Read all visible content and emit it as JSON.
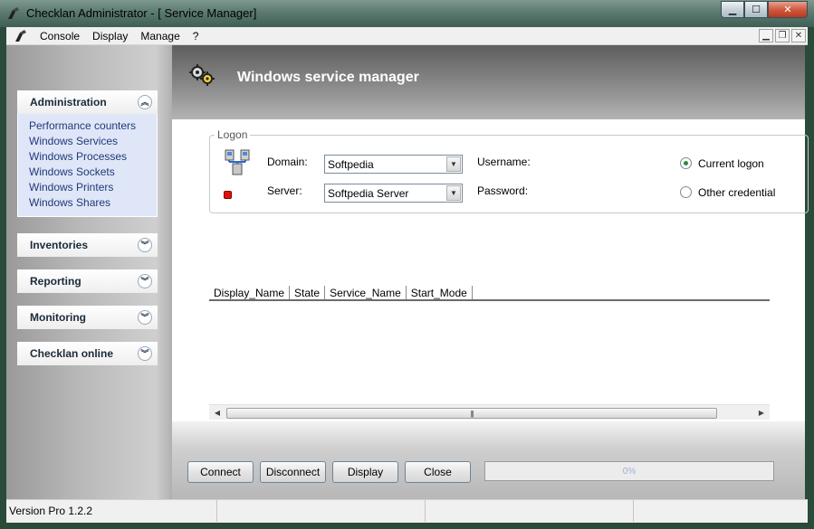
{
  "window": {
    "title": "Checklan Administrator - [ Service Manager]",
    "min_glyph": "▁",
    "max_glyph": "☐",
    "close_glyph": "✕"
  },
  "mdi": {
    "min_glyph": "▁",
    "restore_glyph": "❐",
    "close_glyph": "✕"
  },
  "menu": {
    "items": [
      "Console",
      "Display",
      "Manage",
      "?"
    ]
  },
  "sidebar": {
    "groups": [
      {
        "title": "Administration",
        "expanded": true,
        "chevron": "︽",
        "items": [
          "Performance counters",
          "Windows Services",
          "Windows Processes",
          "Windows Sockets",
          "Windows Printers",
          "Windows Shares"
        ]
      },
      {
        "title": "Inventories",
        "expanded": false,
        "chevron": "︾"
      },
      {
        "title": "Reporting",
        "expanded": false,
        "chevron": "︾"
      },
      {
        "title": "Monitoring",
        "expanded": false,
        "chevron": "︾"
      },
      {
        "title": "Checklan online",
        "expanded": false,
        "chevron": "︾"
      }
    ]
  },
  "main": {
    "title": "Windows service manager",
    "logon": {
      "legend": "Logon",
      "domain_label": "Domain:",
      "domain_value": "Softpedia",
      "server_label": "Server:",
      "server_value": "Softpedia Server",
      "username_label": "Username:",
      "password_label": "Password:",
      "radio_current": "Current logon",
      "radio_other": "Other credential",
      "selected": "current",
      "status_color": "#e01010"
    },
    "table": {
      "columns": [
        "Display_Name",
        "State",
        "Service_Name",
        "Start_Mode"
      ],
      "rows": []
    },
    "scroll_thumb_glyph": "|||",
    "scroll_left": "◀",
    "scroll_right": "▶"
  },
  "buttons": {
    "connect": "Connect",
    "disconnect": "Disconnect",
    "display": "Display",
    "close": "Close"
  },
  "progress": {
    "text": "0%",
    "value": 0
  },
  "status": {
    "version": "Version Pro 1.2.2",
    "cell2": "",
    "cell3": ""
  }
}
